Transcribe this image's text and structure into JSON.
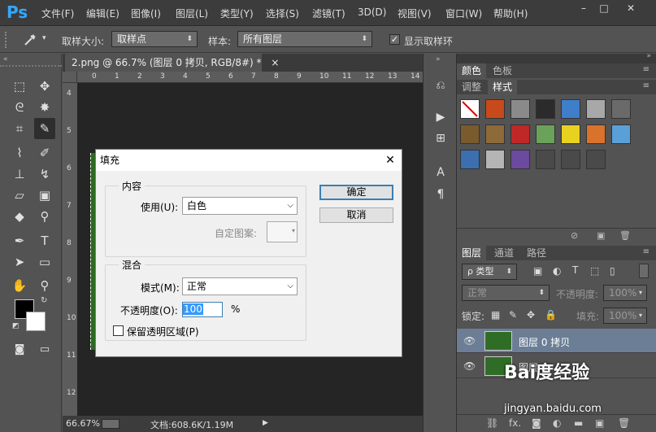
{
  "app": {
    "logo": "Ps"
  },
  "menu": [
    "文件(F)",
    "编辑(E)",
    "图像(I)",
    "图层(L)",
    "类型(Y)",
    "选择(S)",
    "滤镜(T)",
    "3D(D)",
    "视图(V)",
    "窗口(W)",
    "帮助(H)"
  ],
  "window_controls": {
    "minimize": "–",
    "maximize": "□",
    "close": "✕"
  },
  "options": {
    "sample_size_label": "取样大小:",
    "sample_size_value": "取样点",
    "sample_label": "样本:",
    "sample_value": "所有图层",
    "show_ring_label": "显示取样环",
    "show_ring_checked": true
  },
  "document": {
    "tab_title": "2.png @ 66.7% (图层 0 拷贝, RGB/8#) *",
    "tab_close": "×",
    "ruler_top": [
      "0",
      "1",
      "2",
      "3",
      "4",
      "5",
      "6",
      "7",
      "8",
      "9",
      "10",
      "11",
      "12",
      "13",
      "14"
    ],
    "ruler_left": [
      "4",
      "5",
      "6",
      "7",
      "8",
      "9",
      "10",
      "11",
      "12"
    ]
  },
  "status": {
    "zoom": "66.67%",
    "doc_info": "文档:608.6K/1.19M",
    "arrow": "▶"
  },
  "panels": {
    "top_tabs": [
      "颜色",
      "色板"
    ],
    "style_tabs": [
      "调整",
      "样式"
    ],
    "style_swatches": [
      {
        "color": "#ffffff",
        "icon": "none-style-icon"
      },
      {
        "color": "#c84a1a"
      },
      {
        "color": "#8a8a8a"
      },
      {
        "color": "#2b2b2b"
      },
      {
        "color": "#3f7ec9"
      },
      {
        "color": "#a8a8a8"
      },
      {
        "color": "#6a6a6a"
      },
      {
        "color": "#7a5b2d"
      },
      {
        "color": "#8c6a3a"
      },
      {
        "color": "#c02727"
      },
      {
        "color": "#6aa25a"
      },
      {
        "color": "#e8d21f"
      },
      {
        "color": "#d9722a"
      },
      {
        "color": "#5aa0d8"
      },
      {
        "color": "#3b6fb0"
      },
      {
        "color": "#b5b5b5"
      },
      {
        "color": "#6b4aa0"
      },
      {
        "color": "#4a4a4a"
      },
      {
        "color": "#4a4a4a"
      },
      {
        "color": "#4a4a4a"
      }
    ],
    "layers_tabs": [
      "图层",
      "通道",
      "路径"
    ],
    "filter_kind": "ρ 类型",
    "blend_mode": "正常",
    "opacity_label": "不透明度:",
    "opacity_value": "100%",
    "lock_label": "锁定:",
    "fill_label": "填充:",
    "fill_value": "100%",
    "layers": [
      {
        "name": "图层 0 拷贝",
        "selected": true
      },
      {
        "name": "图层 0",
        "selected": false
      }
    ],
    "bottom_icons": [
      "link-icon",
      "fx-icon",
      "mask-icon",
      "adjustment-icon",
      "group-icon",
      "new-layer-icon",
      "trash-icon"
    ],
    "fx_label": "fx."
  },
  "dialog": {
    "title": "填充",
    "close": "✕",
    "contents_group": "内容",
    "use_label": "使用(U):",
    "use_value": "白色",
    "custom_pattern_label": "自定图案:",
    "blending_group": "混合",
    "mode_label": "模式(M):",
    "mode_value": "正常",
    "opacity_label": "不透明度(O):",
    "opacity_value": "100",
    "opacity_unit": "%",
    "preserve_label": "保留透明区域(P)",
    "preserve_checked": false,
    "ok_label": "确定",
    "cancel_label": "取消"
  },
  "watermark": {
    "logo_text": "Bai度经验",
    "url": "jingyan.baidu.com"
  }
}
